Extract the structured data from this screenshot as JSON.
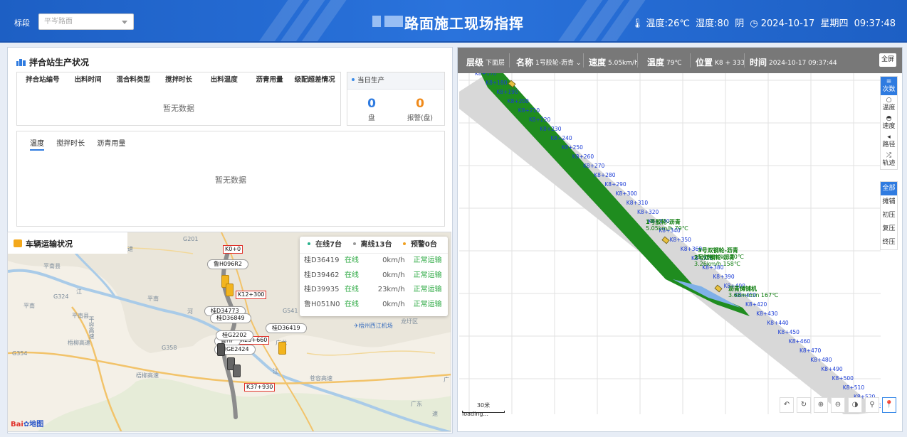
{
  "header": {
    "section_label": "标段",
    "section_select": "平岑路面",
    "title": "路面施工现场指挥",
    "temperature": "温度:26℃",
    "humidity": "湿度:80",
    "weather": "阴",
    "date": "2024-10-17",
    "weekday": "星期四",
    "time": "09:37:48"
  },
  "mixing": {
    "title": "拌合站生产状况",
    "columns": [
      "拌合站编号",
      "出料时间",
      "混合料类型",
      "搅拌时长",
      "出料温度",
      "沥青用量",
      "级配超差情况"
    ],
    "empty_text": "暂无数据",
    "today_title": "当日生产",
    "today_count": "0",
    "today_count_label": "盘",
    "alarm_count": "0",
    "alarm_count_label": "报警(盘)",
    "tabs": [
      "温度",
      "搅拌时长",
      "沥青用量"
    ],
    "tab_empty_text": "暂无数据"
  },
  "vehicles": {
    "title": "车辆运输状况",
    "legend": [
      {
        "label": "在线7台",
        "color": "#27b28c"
      },
      {
        "label": "离线13台",
        "color": "#999999"
      },
      {
        "label": "预警0台",
        "color": "#f0a020"
      }
    ],
    "rows": [
      {
        "plate": "桂D36419",
        "status": "在线",
        "speed": "0km/h",
        "state": "正常运输"
      },
      {
        "plate": "桂D39462",
        "status": "在线",
        "speed": "0km/h",
        "state": "正常运输"
      },
      {
        "plate": "桂D39935",
        "status": "在线",
        "speed": "23km/h",
        "state": "正常运输"
      },
      {
        "plate": "鲁H051N0",
        "status": "在线",
        "speed": "0km/h",
        "state": "正常运输"
      }
    ],
    "map_labels": [
      "平南县",
      "平南",
      "平南县",
      "G201",
      "G324",
      "平南",
      "平容高速",
      "梧柳高速",
      "梧柳高速",
      "G358",
      "G354",
      "广龙",
      "梧州西江机场",
      "龙圩区",
      "苍容高速",
      "G541",
      "速",
      "速",
      "河",
      "江",
      "江",
      "广东",
      "广"
    ],
    "kms": [
      "K0+0",
      "K12+300",
      "K25+660",
      "K37+930"
    ],
    "plates_on_map": [
      "鲁H096R2",
      "桂D34773",
      "桂D36849",
      "桂D36419",
      "鲁HF",
      "桂G2202",
      "豫GE2424"
    ],
    "brand": "Bai",
    "brand2": "地图"
  },
  "road": {
    "layer_label": "层级",
    "layer_value": "下面层",
    "name_label": "名称",
    "name_value": "1号胶轮-沥青",
    "speed_label": "速度",
    "speed_value": "5.05km/h",
    "temp_label": "温度",
    "temp_value": "79℃",
    "pos_label": "位置",
    "pos_value": "K8 + 333",
    "time_label": "时间",
    "time_value": "2024-10-17 09:37:44",
    "full_btn": "全屏",
    "tools_top": [
      "次数",
      "温度",
      "速度",
      "路径",
      "轨迹"
    ],
    "tools_filter": [
      "全部",
      "摊铺",
      "初压",
      "复压",
      "终压"
    ],
    "scale": "30米",
    "loading": "loading...",
    "stations": [
      "K8+170",
      "K8+180",
      "K8+190",
      "K8+200",
      "K8+210",
      "K8+220",
      "K8+230",
      "K8+240",
      "K8+250",
      "K8+260",
      "K8+270",
      "K8+280",
      "K8+290",
      "K8+300",
      "K8+310",
      "K8+320",
      "K8+330",
      "K8+340",
      "K8+350",
      "K8+360",
      "K8+370",
      "K8+380",
      "K8+390",
      "K8+400",
      "K8+410",
      "K8+420",
      "K8+430",
      "K8+440",
      "K8+450",
      "K8+460",
      "K8+470",
      "K8+480",
      "K8+490",
      "K8+500",
      "K8+510",
      "K8+520",
      "K8+530"
    ],
    "machines": [
      {
        "name": "1号胶轮-沥青",
        "info": "5.05km/h 79℃"
      },
      {
        "name": "3号双钢轮-沥青",
        "info": "5.09km/h 170℃"
      },
      {
        "name": "2号双钢轮-沥青",
        "info": "3.26km/h 158℃"
      },
      {
        "name": "沥青摊铺机",
        "info": "3.66m/min 167℃"
      }
    ]
  }
}
